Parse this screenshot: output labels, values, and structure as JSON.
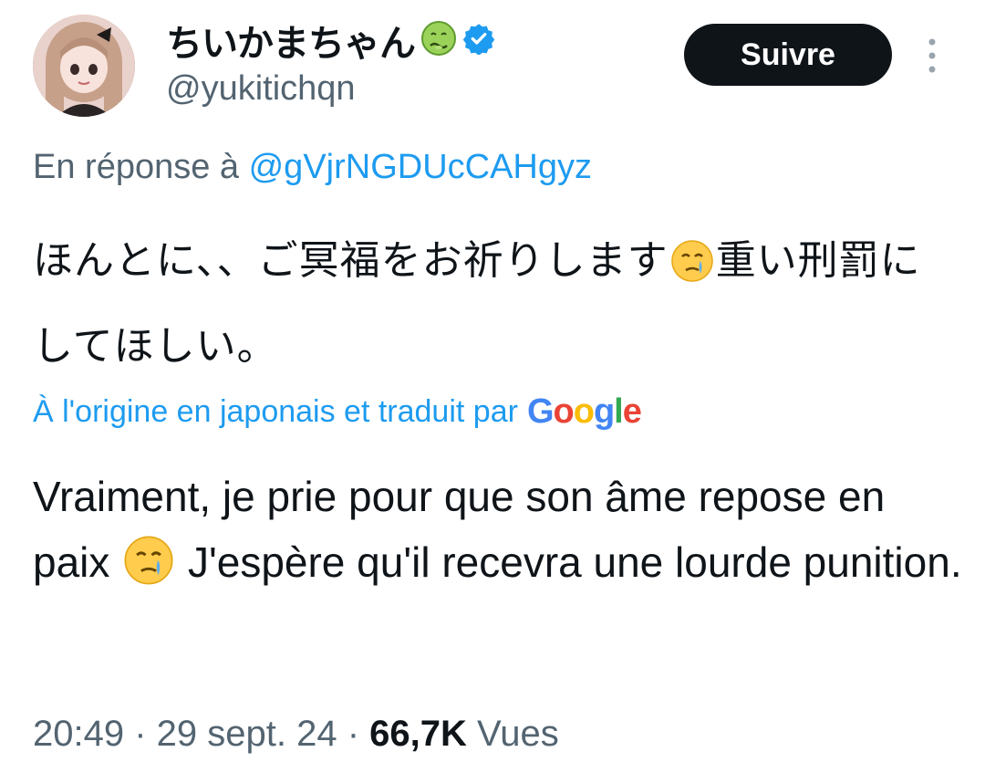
{
  "header": {
    "display_name": "ちいかまちゃん",
    "name_emoji": "nauseated-face-icon",
    "verified": "verified-badge-icon",
    "handle": "@yukitichqn",
    "follow_label": "Suivre",
    "more_icon": "more-vertical-icon"
  },
  "reply": {
    "prefix": "En réponse à ",
    "mention": "@gVjrNGDUcCAHgyz"
  },
  "tweet": {
    "original_part1": "ほんとに、、ご冥福をお祈りします",
    "original_emoji": "face-holding-back-tears-icon",
    "original_part2": "重い刑罰にしてほしい。",
    "translation_note": "À l'origine en japonais et traduit par",
    "translation_provider": "Google",
    "translated_part1": "Vraiment, je prie pour que son âme repose en paix ",
    "translated_emoji": "face-holding-back-tears-icon",
    "translated_part2": " J'espère qu'il recevra une lourde punition."
  },
  "meta": {
    "time": "20:49",
    "separator": " · ",
    "date": "29 sept. 24",
    "views_count": "66,7K",
    "views_label": " Vues"
  },
  "colors": {
    "accent": "#1d9bf0",
    "text_primary": "#0f1419",
    "text_secondary": "#536471",
    "button_bg": "#0f1419"
  }
}
